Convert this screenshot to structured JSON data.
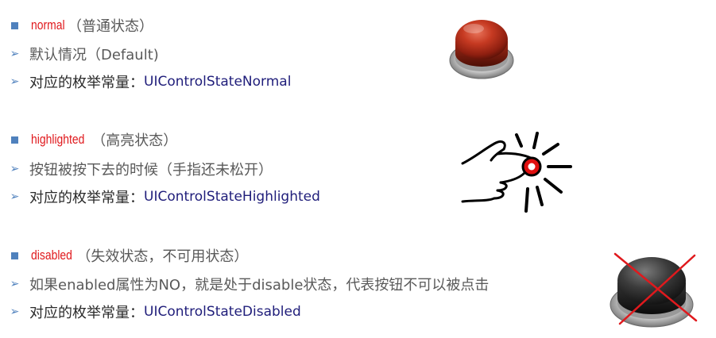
{
  "sections": [
    {
      "state": "normal",
      "state_desc": "（普通状态）",
      "line2": "默认情况（Default)",
      "const_label": "对应的枚举常量：",
      "const_value": "UIControlStateNormal"
    },
    {
      "state": "highlighted",
      "state_desc": "（高亮状态）",
      "line2": "按钮被按下去的时候（手指还未松开）",
      "const_label": "对应的枚举常量：",
      "const_value": "UIControlStateHighlighted"
    },
    {
      "state": "disabled",
      "state_desc": "（失效状态，不可用状态）",
      "line2": "如果enabled属性为NO，就是处于disable状态，代表按钮不可以被点击",
      "const_label": "对应的枚举常量：",
      "const_value": "UIControlStateDisabled"
    }
  ],
  "images": {
    "normal": "red-push-button-icon",
    "highlighted": "finger-press-icon",
    "disabled": "gray-disabled-button-icon"
  },
  "colors": {
    "bullet": "#4f81bd",
    "state_name": "#e0191d",
    "const_value": "#1f1d7a",
    "description": "#595959",
    "cross": "#e0191d"
  }
}
